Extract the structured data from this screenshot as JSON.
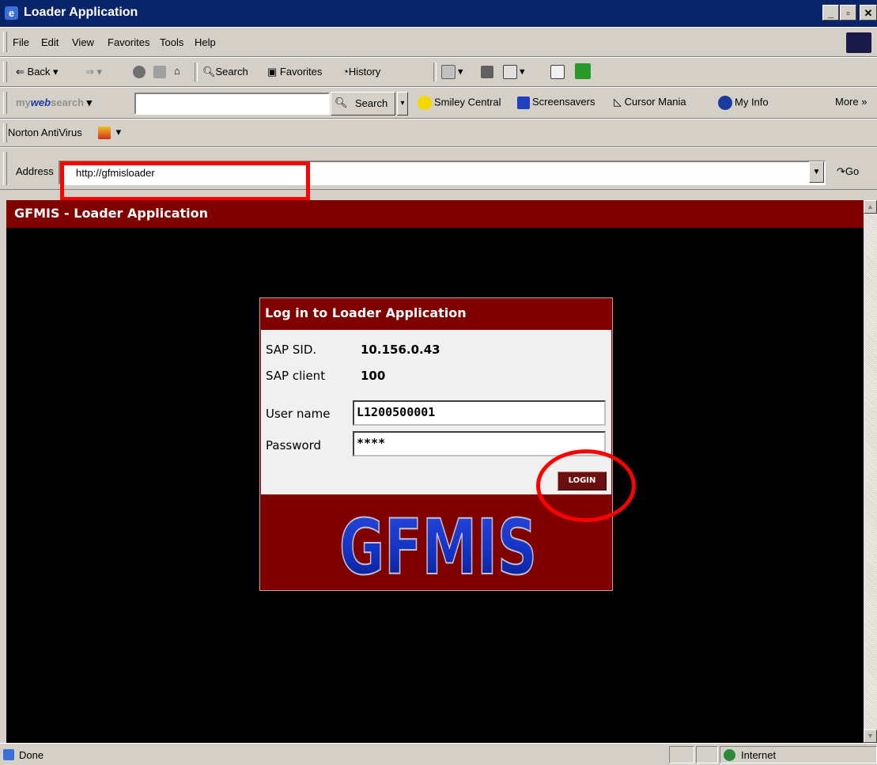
{
  "window": {
    "title": "Loader Application"
  },
  "menu": [
    "File",
    "Edit",
    "View",
    "Favorites",
    "Tools",
    "Help"
  ],
  "toolbar": {
    "back": "Back",
    "search": "Search",
    "favorites": "Favorites",
    "history": "History"
  },
  "websearch": {
    "brand_prefix": "my",
    "brand_web": "web",
    "brand_suffix": "search",
    "search_button": "Search",
    "links": [
      "Smiley Central",
      "Screensavers",
      "Cursor Mania",
      "My Info"
    ],
    "more": "More"
  },
  "norton": {
    "label": "Norton AntiVirus"
  },
  "address": {
    "label": "Address",
    "url": "http://gfmisloader",
    "go": "Go"
  },
  "page": {
    "header": "GFMIS - Loader Application",
    "login": {
      "title": "Log in to Loader Application",
      "sap_sid_label": "SAP SID.",
      "sap_sid_value": "10.156.0.43",
      "sap_client_label": "SAP client",
      "sap_client_value": "100",
      "username_label": "User name",
      "username_value": "L1200500001",
      "password_label": "Password",
      "password_value": "****",
      "login_button": "LOGIN",
      "logo_text": "GFMIS"
    }
  },
  "status": {
    "text": "Done",
    "zone": "Internet"
  },
  "colors": {
    "maroon": "#800000",
    "title_blue": "#0a246a",
    "annotation_red": "#ff0000",
    "logo_blue": "#1030c0"
  }
}
